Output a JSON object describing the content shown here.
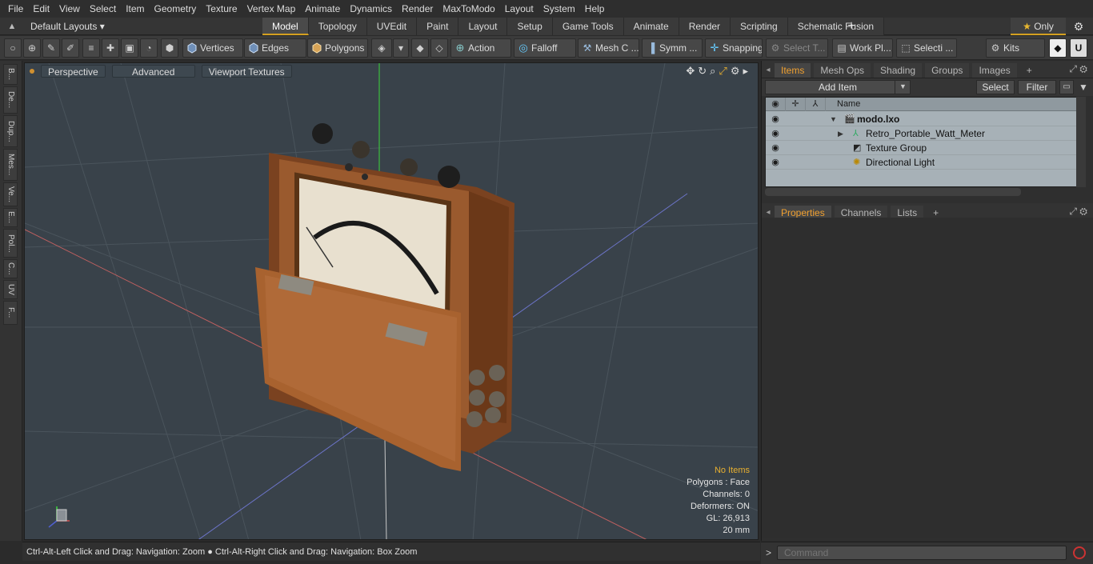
{
  "menubar": {
    "items": [
      "File",
      "Edit",
      "View",
      "Select",
      "Item",
      "Geometry",
      "Texture",
      "Vertex Map",
      "Animate",
      "Dynamics",
      "Render",
      "MaxToModo",
      "Layout",
      "System",
      "Help"
    ]
  },
  "layoutbar": {
    "layout_select": "Default Layouts ▾",
    "tabs": [
      "Model",
      "Topology",
      "UVEdit",
      "Paint",
      "Layout",
      "Setup",
      "Game Tools",
      "Animate",
      "Render",
      "Scripting",
      "Schematic Fusion"
    ],
    "active_tab": "Model",
    "add": "+",
    "only_label": "Only",
    "star": "★"
  },
  "toolbar": {
    "vertices": "Vertices",
    "edges": "Edges",
    "polygons": "Polygons",
    "action": "Action",
    "falloff": "Falloff",
    "mesh_c": "Mesh C ...",
    "symm": "Symm ...",
    "snapping": "Snapping",
    "select_t": "Select T...",
    "work_pl": "Work Pl...",
    "selecti": "Selecti ...",
    "kits": "Kits"
  },
  "left_tabs": [
    "B...",
    "De...",
    "Dup...",
    "Mes...",
    "Ve...",
    "E...",
    "Pol...",
    "C...",
    "UV",
    "F..."
  ],
  "viewport": {
    "perspective": "Perspective",
    "advanced": "Advanced",
    "viewport_textures": "Viewport Textures",
    "info": {
      "no_items": "No Items",
      "polygons": "Polygons : Face",
      "channels": "Channels: 0",
      "deformers": "Deformers: ON",
      "gl": "GL: 26,913",
      "scale": "20 mm"
    }
  },
  "status": "Ctrl-Alt-Left Click and Drag: Navigation: Zoom ● Ctrl-Alt-Right Click and Drag: Navigation: Box Zoom",
  "items_panel": {
    "tabs": [
      "Items",
      "Mesh Ops",
      "Shading",
      "Groups",
      "Images"
    ],
    "active": "Items",
    "add_item": "Add Item",
    "select": "Select",
    "filter": "Filter",
    "col_name": "Name",
    "rows": [
      {
        "label": "modo.lxo"
      },
      {
        "label": "Retro_Portable_Watt_Meter"
      },
      {
        "label": "Texture Group"
      },
      {
        "label": "Directional Light"
      }
    ]
  },
  "props_panel": {
    "tabs": [
      "Properties",
      "Channels",
      "Lists"
    ],
    "active": "Properties"
  },
  "command": {
    "placeholder": "Command"
  },
  "colors": {
    "accent": "#d4a020",
    "viewport_bg": "#39424a",
    "wood": "#9a5a2e"
  }
}
